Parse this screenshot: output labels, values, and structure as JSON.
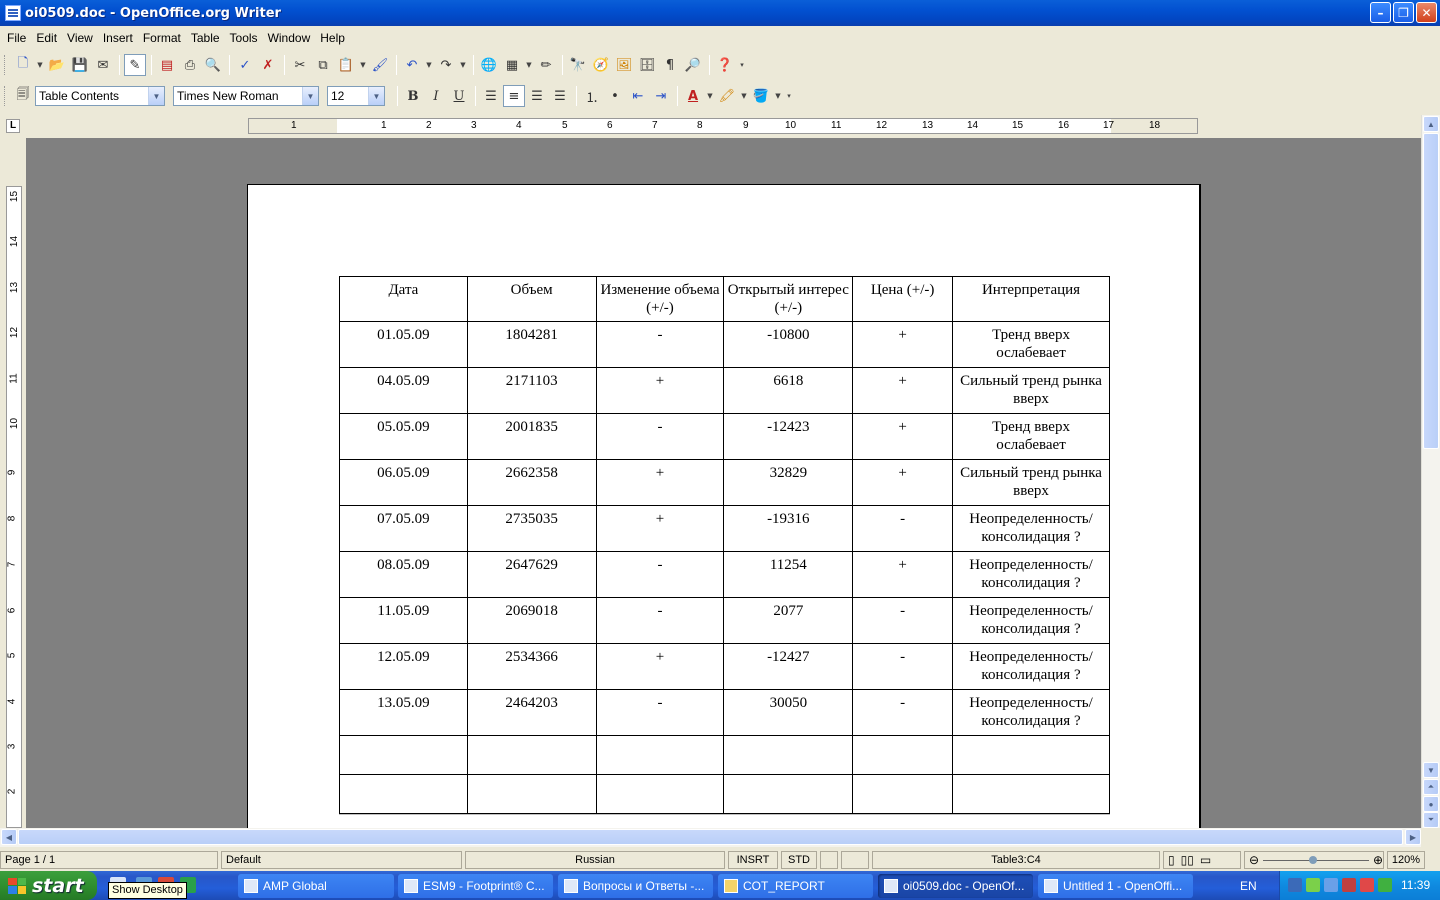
{
  "window": {
    "title": "oi0509.doc - OpenOffice.org Writer",
    "minimize_glyph": "–",
    "restore_glyph": "❐",
    "close_glyph": "✕"
  },
  "menu": [
    "File",
    "Edit",
    "View",
    "Insert",
    "Format",
    "Table",
    "Tools",
    "Window",
    "Help"
  ],
  "formatting": {
    "paragraph_style": "Table Contents",
    "font_name": "Times New Roman",
    "font_size": "12",
    "bold": "B",
    "italic": "I",
    "underline": "U",
    "font_color_glyph": "A"
  },
  "ruler": {
    "corner": "L",
    "h_numbers": [
      "1",
      "1",
      "2",
      "3",
      "4",
      "5",
      "6",
      "7",
      "8",
      "9",
      "10",
      "11",
      "12",
      "13",
      "14",
      "15",
      "16",
      "17",
      "18"
    ],
    "v_numbers": [
      "15",
      "14",
      "13",
      "12",
      "11",
      "10",
      "9",
      "8",
      "7",
      "6",
      "5",
      "4",
      "3",
      "2"
    ]
  },
  "table": {
    "headers": [
      "Дата",
      "Объем",
      "Изменение объема (+/-)",
      "Открытый интерес (+/-)",
      "Цена (+/-)",
      "Интерпретация"
    ],
    "rows": [
      [
        "01.05.09",
        "1804281",
        "-",
        "-10800",
        "+",
        "Тренд вверх ослабевает"
      ],
      [
        "04.05.09",
        "2171103",
        "+",
        "6618",
        "+",
        "Сильный тренд рынка вверх"
      ],
      [
        "05.05.09",
        "2001835",
        "-",
        "-12423",
        "+",
        "Тренд вверх ослабевает"
      ],
      [
        "06.05.09",
        "2662358",
        "+",
        "32829",
        "+",
        "Сильный тренд рынка вверх"
      ],
      [
        "07.05.09",
        "2735035",
        "+",
        "-19316",
        "-",
        "Неопределенность/ консолидация ?"
      ],
      [
        "08.05.09",
        "2647629",
        "-",
        "11254",
        "+",
        "Неопределенность/ консолидация ?"
      ],
      [
        "11.05.09",
        "2069018",
        "-",
        "2077",
        "-",
        "Неопределенность/ консолидация ?"
      ],
      [
        "12.05.09",
        "2534366",
        "+",
        "-12427",
        "-",
        "Неопределенность/ консолидация ?"
      ],
      [
        "13.05.09",
        "2464203",
        "-",
        "30050",
        "-",
        "Неопределенность/ консолидация ?"
      ]
    ],
    "empty_rows": 2
  },
  "status": {
    "page": "Page 1 / 1",
    "page_style": "Default",
    "language": "Russian",
    "insert_mode": "INSRT",
    "selection_mode": "STD",
    "cell": "Table3:C4",
    "zoom": "120%"
  },
  "taskbar": {
    "start": "start",
    "tooltip": "Show Desktop",
    "tasks": [
      {
        "label": "AMP Global",
        "active": false
      },
      {
        "label": "ESM9 - Footprint® C...",
        "active": false
      },
      {
        "label": "Вопросы и Ответы -...",
        "active": false
      },
      {
        "label": "COT_REPORT",
        "active": false
      },
      {
        "label": "oi0509.doc - OpenOf...",
        "active": true
      },
      {
        "label": "Untitled 1 - OpenOffi...",
        "active": false
      }
    ],
    "language": "EN",
    "clock": "11:39"
  },
  "colors": {
    "titlebar": "#0250d0",
    "taskbar": "#245ed9",
    "start_green": "#2f8f2f",
    "workspace_gray": "#808080",
    "tray_blue": "#0f8ae0"
  }
}
